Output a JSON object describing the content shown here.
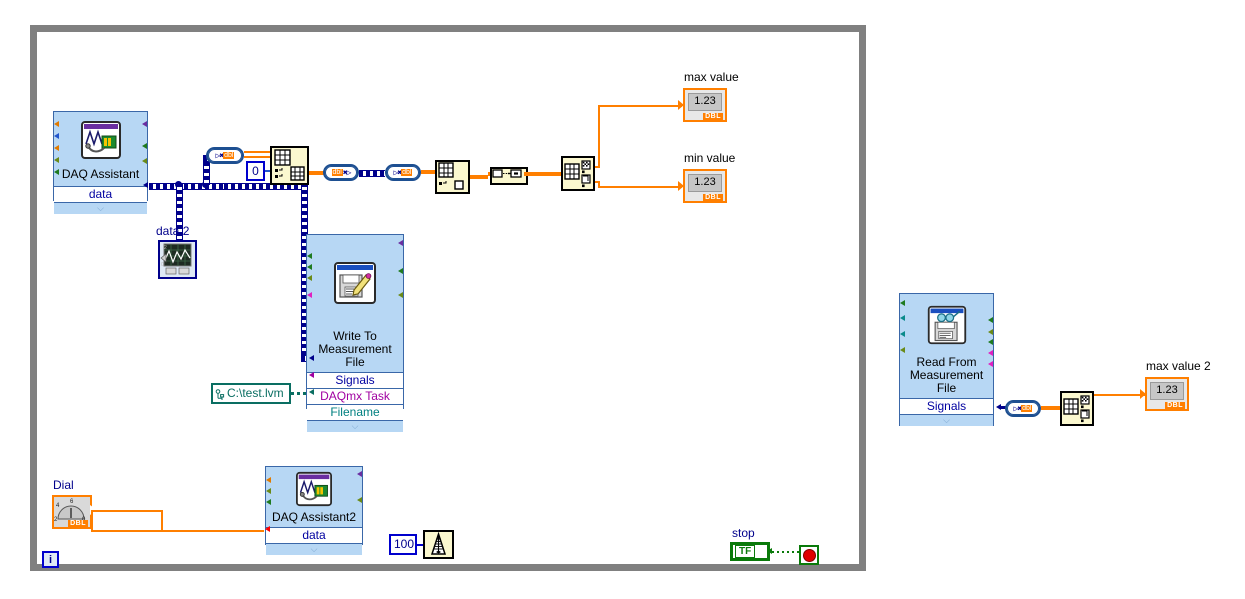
{
  "app": {
    "type": "labview-block-diagram",
    "background": "#ffffff",
    "loop_border_color": "#808080"
  },
  "palette": {
    "express_vi_fill": "#b7d7f4",
    "express_vi_border": "#3a67a8",
    "dynamic_wire": "#00008b",
    "numeric_wire": "#ff7f00",
    "boolean_wire": "#0a7a0a",
    "path_wire": "#0a6e62",
    "function_fill": "#fbf8cf",
    "indicator_border": "#ff7f00"
  },
  "nodes": {
    "daq_assistant": {
      "title": "DAQ Assistant",
      "terminal": "data",
      "icon": "daq-device-icon"
    },
    "daq_assistant2": {
      "title": "DAQ Assistant2",
      "terminal": "data",
      "icon": "daq-device-icon"
    },
    "write_to_measurement_file": {
      "title_line1": "Write To",
      "title_line2": "Measurement",
      "title_line3": "File",
      "terminals": [
        "Signals",
        "DAQmx Task",
        "Filename"
      ],
      "icon": "write-file-icon"
    },
    "read_from_measurement_file": {
      "title_line1": "Read From",
      "title_line2": "Measurement",
      "title_line3": "File",
      "terminals": [
        "Signals"
      ],
      "icon": "read-file-icon"
    },
    "index_array": {
      "name": "index-array-function",
      "icon": "index-array-icon"
    },
    "array_max_min": {
      "name": "array-max-min-function",
      "icon": "array-max-min-icon"
    },
    "array_max_min_2": {
      "name": "array-max-min-function-2",
      "icon": "array-max-min-icon"
    },
    "array_subset": {
      "name": "array-subset-function",
      "icon": "array-subset-icon"
    },
    "convert_to_dynamic_a": {
      "name": "convert-from-dynamic-data",
      "glyph": "▶",
      "label": "dbl"
    },
    "wait_ms": {
      "name": "wait-until-next-ms-multiple",
      "icon": "metronome-icon",
      "constant": "100"
    },
    "stop_node": {
      "name": "stop-function",
      "icon": "stop-sign-icon"
    }
  },
  "controls_indicators": {
    "max_value": {
      "label": "max value",
      "value": "1.23",
      "datatype": "DBL"
    },
    "min_value": {
      "label": "min value",
      "value": "1.23",
      "datatype": "DBL"
    },
    "max_value_2": {
      "label": "max value 2",
      "value": "1.23",
      "datatype": "DBL"
    },
    "data2_graph": {
      "label": "data 2",
      "icon": "waveform-graph-icon"
    },
    "dial": {
      "label": "Dial",
      "datatype": "DBL",
      "icon": "dial-knob-icon",
      "tick_labels": [
        "2",
        "4",
        "6",
        "0"
      ]
    },
    "stop": {
      "label": "stop",
      "value": "TF"
    },
    "iteration": {
      "label": "i"
    },
    "file_path_constant": {
      "value": "C:\\test.lvm",
      "icon": "path-icon"
    },
    "index_constant": {
      "value": "0"
    },
    "wait_constant": {
      "value": "100"
    }
  },
  "wire_labels": {
    "dynamic_data": "dynamic data (dashed dark blue)",
    "numeric_scalar": "orange thin",
    "numeric_array": "orange thick"
  }
}
